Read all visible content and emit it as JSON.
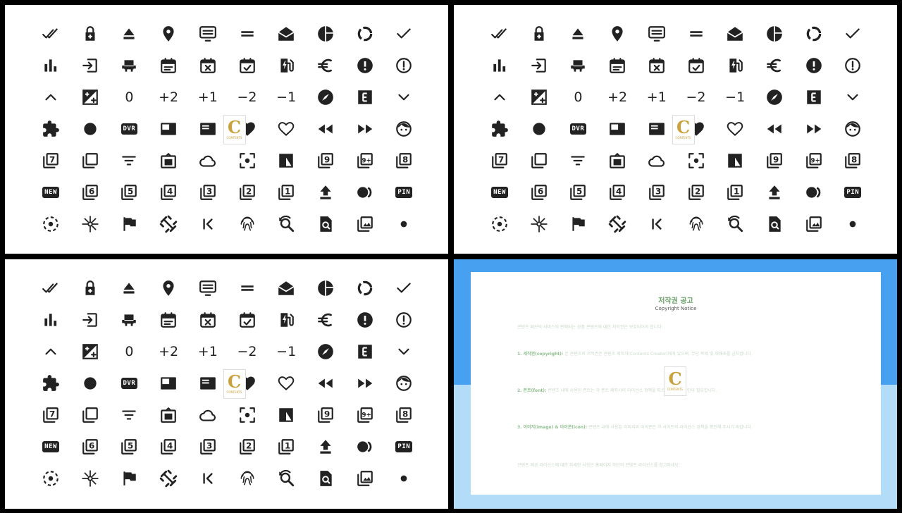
{
  "icon_rows": [
    [
      {
        "k": "done-all-icon"
      },
      {
        "k": "lock-plus-icon"
      },
      {
        "k": "eject-icon"
      },
      {
        "k": "location-pin-icon"
      },
      {
        "k": "display-list-icon"
      },
      {
        "k": "equal-icon"
      },
      {
        "k": "drafts-icon"
      },
      {
        "k": "pie-chart-icon"
      },
      {
        "k": "data-usage-icon"
      },
      {
        "k": "check-icon"
      }
    ],
    [
      {
        "k": "bar-chart-icon"
      },
      {
        "k": "input-icon"
      },
      {
        "k": "seat-icon"
      },
      {
        "k": "event-note-icon"
      },
      {
        "k": "event-busy-icon"
      },
      {
        "k": "event-available-icon"
      },
      {
        "k": "ev-station-icon"
      },
      {
        "k": "euro-symbol-icon"
      },
      {
        "k": "error-icon"
      },
      {
        "k": "error-outline-icon"
      }
    ],
    [
      {
        "k": "expand-less-icon"
      },
      {
        "k": "exposure-icon"
      },
      {
        "k": "exposure-zero",
        "t": "0"
      },
      {
        "k": "exposure-plus-2",
        "t": "+2"
      },
      {
        "k": "exposure-plus-1",
        "t": "+1"
      },
      {
        "k": "exposure-neg-2",
        "t": "−2"
      },
      {
        "k": "exposure-neg-1",
        "t": "−1"
      },
      {
        "k": "explore-icon"
      },
      {
        "k": "explicit-icon"
      },
      {
        "k": "expand-more-icon"
      }
    ],
    [
      {
        "k": "extension-icon"
      },
      {
        "k": "fiber-manual-record-icon"
      },
      {
        "k": "dvr-badge",
        "b": "DVR"
      },
      {
        "k": "featured-video-icon"
      },
      {
        "k": "featured-play-list-icon"
      },
      {
        "k": "favorite-icon"
      },
      {
        "k": "favorite-border-icon"
      },
      {
        "k": "fast-rewind-icon"
      },
      {
        "k": "fast-forward-icon"
      },
      {
        "k": "face-icon"
      }
    ],
    [
      {
        "k": "filter-7-icon",
        "n": "7"
      },
      {
        "k": "filter-none-icon"
      },
      {
        "k": "filter-list-icon"
      },
      {
        "k": "filter-frames-icon"
      },
      {
        "k": "filter-drama-icon"
      },
      {
        "k": "filter-center-focus-icon"
      },
      {
        "k": "filter-b-and-w-icon"
      },
      {
        "k": "filter-9-icon",
        "n": "9"
      },
      {
        "k": "filter-9-plus-icon",
        "n": "9+"
      },
      {
        "k": "filter-8-icon",
        "n": "8"
      }
    ],
    [
      {
        "k": "fiber-new-badge",
        "b": "NEW"
      },
      {
        "k": "filter-6-icon",
        "n": "6"
      },
      {
        "k": "filter-5-icon",
        "n": "5"
      },
      {
        "k": "filter-4-icon",
        "n": "4"
      },
      {
        "k": "filter-3-icon",
        "n": "3"
      },
      {
        "k": "filter-2-icon",
        "n": "2"
      },
      {
        "k": "filter-1-icon",
        "n": "1"
      },
      {
        "k": "file-upload-icon"
      },
      {
        "k": "flip-icon"
      },
      {
        "k": "fiber-pin-badge",
        "b": "PIN"
      }
    ],
    [
      {
        "k": "filter-tilt-shift-icon"
      },
      {
        "k": "flare-icon"
      },
      {
        "k": "flag-icon"
      },
      {
        "k": "fitness-center-icon"
      },
      {
        "k": "first-page-icon"
      },
      {
        "k": "fingerprint-icon"
      },
      {
        "k": "find-replace-icon"
      },
      {
        "k": "find-in-page-icon"
      },
      {
        "k": "filter-photo-icon"
      },
      {
        "k": "dot-icon"
      }
    ]
  ],
  "logo": {
    "letter": "C",
    "text": "CONTENTS"
  },
  "notice": {
    "title": "저작권 공고",
    "subtitle": "Copyright Notice",
    "intro": "콘텐츠 패브릭 서비스의 판매되는 상품 콘텐츠에 대한 저작권은 보호되어야 합니다.",
    "p1_head": "1. 세작권(copyright):",
    "p1_body": "본 콘텐츠의 저작권은 콘텐츠 제작자(Contents Creator)에게 있으며, 무단 복제 및 재배포를 금지합니다.",
    "p2_head": "2. 폰트(font):",
    "p2_body": "콘텐츠 내에 사용된 폰트는 각 폰트 제작사의 라이선스 정책을 따르며 별도로 확인이 필요합니다.",
    "p3_head": "3. 이미지(image) & 아이콘(icon):",
    "p3_body": "콘텐츠 내에 사용된 이미지와 아이콘은 각 사이트의 라이선스 정책을 확인해 주시기 바랍니다.",
    "outro": "콘텐츠 제공 라이선스에 대한 자세한 사항은 홈페이지 하단의 콘텐츠 라이선스를 참고하세요."
  }
}
